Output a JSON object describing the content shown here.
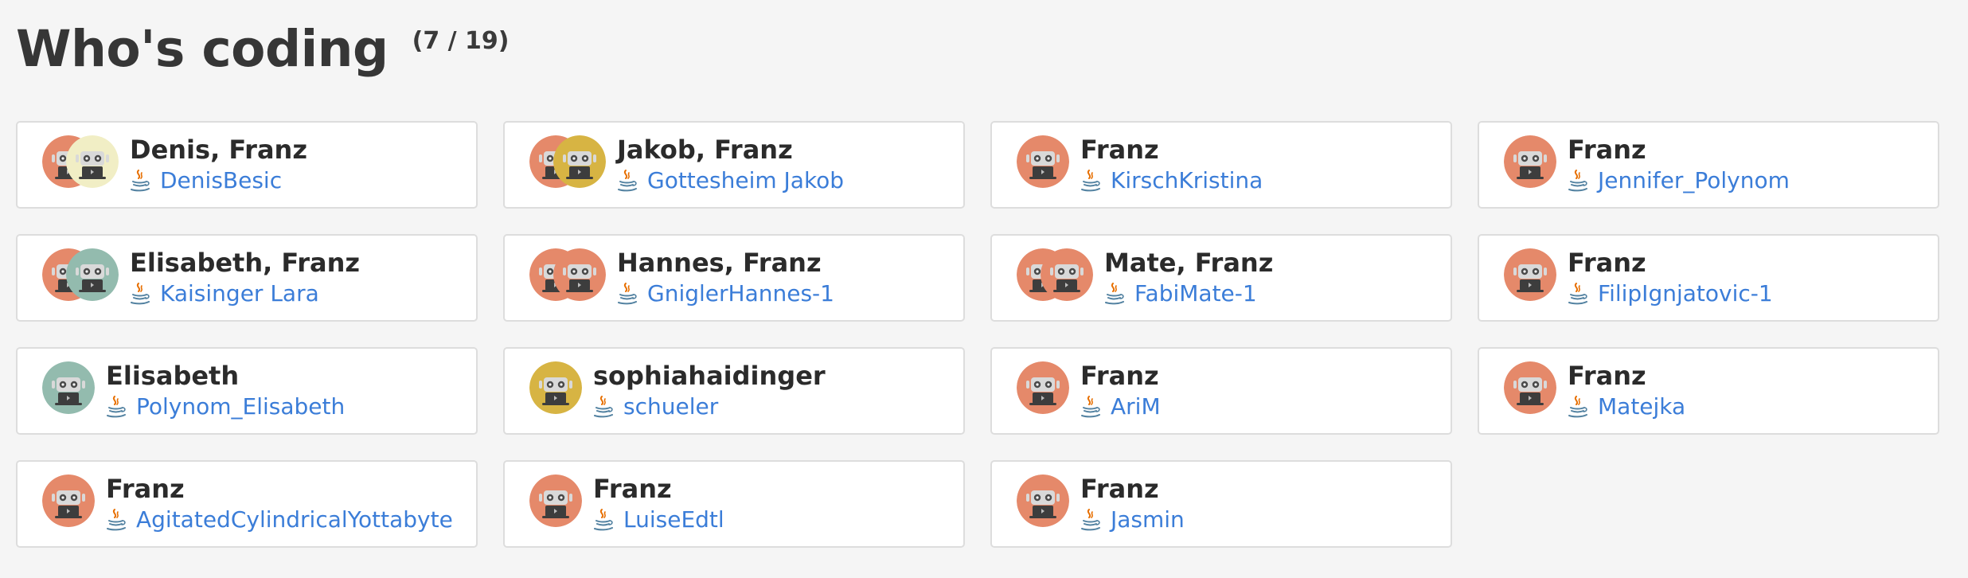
{
  "header": {
    "title": "Who's coding",
    "count": "(7 / 19)"
  },
  "colors": {
    "orange": "#e5896a",
    "cream": "#f1eec5",
    "sage": "#93bbae",
    "gold": "#d7b443",
    "link": "#3b7dd8"
  },
  "cards": [
    {
      "names": "Denis, Franz",
      "session": "DenisBesic",
      "avatars": [
        "orange",
        "cream"
      ],
      "language_icon": "java-icon"
    },
    {
      "names": "Jakob, Franz",
      "session": "Gottesheim Jakob",
      "avatars": [
        "orange",
        "gold"
      ],
      "language_icon": "java-icon"
    },
    {
      "names": "Franz",
      "session": "KirschKristina",
      "avatars": [
        "orange"
      ],
      "language_icon": "java-icon"
    },
    {
      "names": "Franz",
      "session": "Jennifer_Polynom",
      "avatars": [
        "orange"
      ],
      "language_icon": "java-icon"
    },
    {
      "names": "Elisabeth, Franz",
      "session": "Kaisinger Lara",
      "avatars": [
        "orange",
        "sage"
      ],
      "language_icon": "java-icon"
    },
    {
      "names": "Hannes, Franz",
      "session": "GniglerHannes-1",
      "avatars": [
        "orange",
        "orange"
      ],
      "language_icon": "java-icon"
    },
    {
      "names": "Mate, Franz",
      "session": "FabiMate-1",
      "avatars": [
        "orange",
        "orange"
      ],
      "language_icon": "java-icon"
    },
    {
      "names": "Franz",
      "session": "FilipIgnjatovic-1",
      "avatars": [
        "orange"
      ],
      "language_icon": "java-icon"
    },
    {
      "names": "Elisabeth",
      "session": "Polynom_Elisabeth",
      "avatars": [
        "sage"
      ],
      "language_icon": "java-icon"
    },
    {
      "names": "sophiahaidinger",
      "session": "schueler",
      "avatars": [
        "gold"
      ],
      "language_icon": "java-icon"
    },
    {
      "names": "Franz",
      "session": "AriM",
      "avatars": [
        "orange"
      ],
      "language_icon": "java-icon"
    },
    {
      "names": "Franz",
      "session": "Matejka",
      "avatars": [
        "orange"
      ],
      "language_icon": "java-icon"
    },
    {
      "names": "Franz",
      "session": "AgitatedCylindricalYottabyte",
      "avatars": [
        "orange"
      ],
      "language_icon": "java-icon"
    },
    {
      "names": "Franz",
      "session": "LuiseEdtl",
      "avatars": [
        "orange"
      ],
      "language_icon": "java-icon"
    },
    {
      "names": "Franz",
      "session": "Jasmin",
      "avatars": [
        "orange"
      ],
      "language_icon": "java-icon"
    }
  ]
}
